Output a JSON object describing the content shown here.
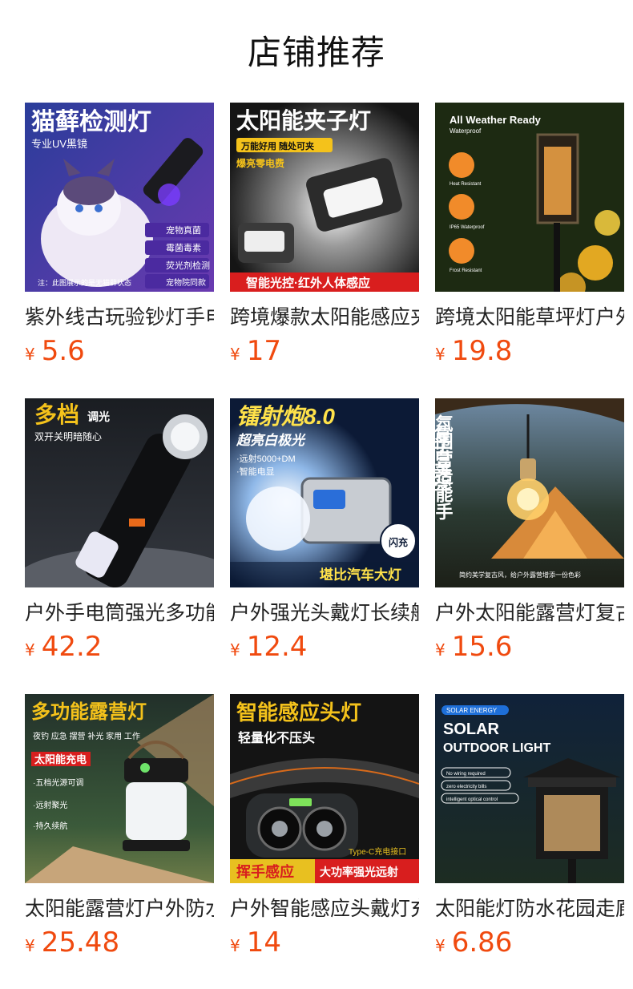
{
  "page_title": "店铺推荐",
  "currency": "¥",
  "products": [
    {
      "name": "紫外线古玩验钞灯手电筒",
      "price": "5.6",
      "image_text": [
        "猫藓检测灯",
        "专业UV黑镜",
        "宠物真菌",
        "霉菌毒素",
        "荧光剂检测",
        "宠物院同款",
        "注：此图展示的是无猫藓状态"
      ]
    },
    {
      "name": "跨境爆款太阳能感应夹子灯",
      "price": "17",
      "image_text": [
        "太阳能夹子灯",
        "万能好用 随处可夹",
        "爆亮零电费",
        "智能光控·红外人体感应"
      ]
    },
    {
      "name": "跨境太阳能草坪灯户外防水",
      "price": "19.8",
      "image_text": [
        "All Weather Ready",
        "Waterproof",
        "Heat Resistant",
        "IP65 Waterproof",
        "Frost Resistant"
      ]
    },
    {
      "name": "户外手电筒强光多功能充电",
      "price": "42.2",
      "image_text": [
        "多档",
        "调光",
        "双开关明暗随心"
      ]
    },
    {
      "name": "户外强光头戴灯长续航充电",
      "price": "12.4",
      "image_text": [
        "镭射炮8.0",
        "超亮白极光",
        "·远射5000+DM",
        "·智能电显",
        "闪充",
        "堪比汽车大灯"
      ]
    },
    {
      "name": "户外太阳能露营灯复古吊灯",
      "price": "15.6",
      "image_text": [
        "复古美学",
        "氛围营造能手",
        "简约美学复古风，给户外露营增添一份色彩"
      ]
    },
    {
      "name": "太阳能露营灯户外防水充电",
      "price": "25.48",
      "image_text": [
        "多功能露营灯",
        "夜钓 应急 摆营 补光 家用 工作",
        "太阳能充电",
        "·五档光源可调",
        "·远射聚光",
        "·持久续航"
      ]
    },
    {
      "name": "户外智能感应头戴灯充电式",
      "price": "14",
      "image_text": [
        "智能感应头灯",
        "轻量化不压头",
        "Type-C充电接口",
        "挥手感应",
        "大功率强光远射"
      ]
    },
    {
      "name": "太阳能灯防水花园走廊壁灯",
      "price": "6.86",
      "image_text": [
        "SOLAR ENERGY",
        "SOLAR",
        "OUTDOOR LIGHT",
        "No wiring required",
        "zero electricity bills",
        "intelligent optical control"
      ]
    }
  ]
}
